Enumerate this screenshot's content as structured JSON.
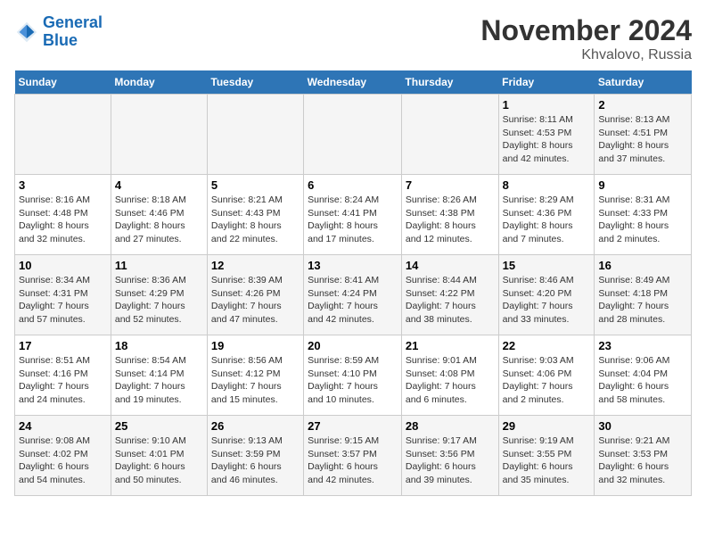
{
  "logo": {
    "text_general": "General",
    "text_blue": "Blue"
  },
  "title": "November 2024",
  "subtitle": "Khvalovo, Russia",
  "weekdays": [
    "Sunday",
    "Monday",
    "Tuesday",
    "Wednesday",
    "Thursday",
    "Friday",
    "Saturday"
  ],
  "weeks": [
    [
      {
        "day": "",
        "info": ""
      },
      {
        "day": "",
        "info": ""
      },
      {
        "day": "",
        "info": ""
      },
      {
        "day": "",
        "info": ""
      },
      {
        "day": "",
        "info": ""
      },
      {
        "day": "1",
        "info": "Sunrise: 8:11 AM\nSunset: 4:53 PM\nDaylight: 8 hours\nand 42 minutes."
      },
      {
        "day": "2",
        "info": "Sunrise: 8:13 AM\nSunset: 4:51 PM\nDaylight: 8 hours\nand 37 minutes."
      }
    ],
    [
      {
        "day": "3",
        "info": "Sunrise: 8:16 AM\nSunset: 4:48 PM\nDaylight: 8 hours\nand 32 minutes."
      },
      {
        "day": "4",
        "info": "Sunrise: 8:18 AM\nSunset: 4:46 PM\nDaylight: 8 hours\nand 27 minutes."
      },
      {
        "day": "5",
        "info": "Sunrise: 8:21 AM\nSunset: 4:43 PM\nDaylight: 8 hours\nand 22 minutes."
      },
      {
        "day": "6",
        "info": "Sunrise: 8:24 AM\nSunset: 4:41 PM\nDaylight: 8 hours\nand 17 minutes."
      },
      {
        "day": "7",
        "info": "Sunrise: 8:26 AM\nSunset: 4:38 PM\nDaylight: 8 hours\nand 12 minutes."
      },
      {
        "day": "8",
        "info": "Sunrise: 8:29 AM\nSunset: 4:36 PM\nDaylight: 8 hours\nand 7 minutes."
      },
      {
        "day": "9",
        "info": "Sunrise: 8:31 AM\nSunset: 4:33 PM\nDaylight: 8 hours\nand 2 minutes."
      }
    ],
    [
      {
        "day": "10",
        "info": "Sunrise: 8:34 AM\nSunset: 4:31 PM\nDaylight: 7 hours\nand 57 minutes."
      },
      {
        "day": "11",
        "info": "Sunrise: 8:36 AM\nSunset: 4:29 PM\nDaylight: 7 hours\nand 52 minutes."
      },
      {
        "day": "12",
        "info": "Sunrise: 8:39 AM\nSunset: 4:26 PM\nDaylight: 7 hours\nand 47 minutes."
      },
      {
        "day": "13",
        "info": "Sunrise: 8:41 AM\nSunset: 4:24 PM\nDaylight: 7 hours\nand 42 minutes."
      },
      {
        "day": "14",
        "info": "Sunrise: 8:44 AM\nSunset: 4:22 PM\nDaylight: 7 hours\nand 38 minutes."
      },
      {
        "day": "15",
        "info": "Sunrise: 8:46 AM\nSunset: 4:20 PM\nDaylight: 7 hours\nand 33 minutes."
      },
      {
        "day": "16",
        "info": "Sunrise: 8:49 AM\nSunset: 4:18 PM\nDaylight: 7 hours\nand 28 minutes."
      }
    ],
    [
      {
        "day": "17",
        "info": "Sunrise: 8:51 AM\nSunset: 4:16 PM\nDaylight: 7 hours\nand 24 minutes."
      },
      {
        "day": "18",
        "info": "Sunrise: 8:54 AM\nSunset: 4:14 PM\nDaylight: 7 hours\nand 19 minutes."
      },
      {
        "day": "19",
        "info": "Sunrise: 8:56 AM\nSunset: 4:12 PM\nDaylight: 7 hours\nand 15 minutes."
      },
      {
        "day": "20",
        "info": "Sunrise: 8:59 AM\nSunset: 4:10 PM\nDaylight: 7 hours\nand 10 minutes."
      },
      {
        "day": "21",
        "info": "Sunrise: 9:01 AM\nSunset: 4:08 PM\nDaylight: 7 hours\nand 6 minutes."
      },
      {
        "day": "22",
        "info": "Sunrise: 9:03 AM\nSunset: 4:06 PM\nDaylight: 7 hours\nand 2 minutes."
      },
      {
        "day": "23",
        "info": "Sunrise: 9:06 AM\nSunset: 4:04 PM\nDaylight: 6 hours\nand 58 minutes."
      }
    ],
    [
      {
        "day": "24",
        "info": "Sunrise: 9:08 AM\nSunset: 4:02 PM\nDaylight: 6 hours\nand 54 minutes."
      },
      {
        "day": "25",
        "info": "Sunrise: 9:10 AM\nSunset: 4:01 PM\nDaylight: 6 hours\nand 50 minutes."
      },
      {
        "day": "26",
        "info": "Sunrise: 9:13 AM\nSunset: 3:59 PM\nDaylight: 6 hours\nand 46 minutes."
      },
      {
        "day": "27",
        "info": "Sunrise: 9:15 AM\nSunset: 3:57 PM\nDaylight: 6 hours\nand 42 minutes."
      },
      {
        "day": "28",
        "info": "Sunrise: 9:17 AM\nSunset: 3:56 PM\nDaylight: 6 hours\nand 39 minutes."
      },
      {
        "day": "29",
        "info": "Sunrise: 9:19 AM\nSunset: 3:55 PM\nDaylight: 6 hours\nand 35 minutes."
      },
      {
        "day": "30",
        "info": "Sunrise: 9:21 AM\nSunset: 3:53 PM\nDaylight: 6 hours\nand 32 minutes."
      }
    ]
  ]
}
